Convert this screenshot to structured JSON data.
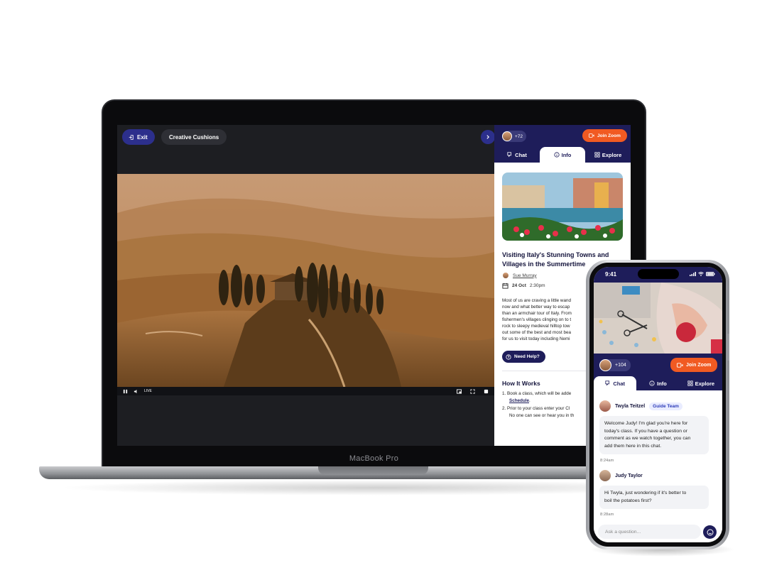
{
  "laptop": {
    "brand": "MacBook Pro",
    "header": {
      "exit_label": "Exit",
      "chip_label": "Creative Cushions"
    },
    "video": {
      "live_label": "LIVE"
    },
    "panel": {
      "attendee_count": "+72",
      "zoom_label": "Join Zoom",
      "tabs": [
        {
          "label": "Chat"
        },
        {
          "label": "Info"
        },
        {
          "label": "Explore"
        }
      ],
      "active_tab": "Info",
      "article": {
        "title_line1": "Visiting Italy's Stunning Towns and",
        "title_line2": "Villages in the Summertime",
        "host": "Sue Murray",
        "date_bold": "24 Oct",
        "time": "2:30pm",
        "body_lines": [
          "Most of us are craving a little wand",
          "now and what better way to escap",
          "than an armchair tour of Italy. From",
          "fishermen's villages clinging on to t",
          "rock to sleepy medieval hilltop tow",
          "out some of the best and most bea",
          "for us to visit today including Nemi"
        ]
      },
      "help_label": "Need Help?",
      "how_title": "How It Works",
      "steps": {
        "s1_a": "1. Book a class, which will be adde",
        "s1_b": "Schedule",
        "s1_b_tail": ".",
        "s2_a": "2. Prior to your class enter your Cl",
        "s2_b": "No one can see or hear you in th"
      }
    }
  },
  "phone": {
    "status_time": "9:41",
    "attendee_count": "+104",
    "zoom_label": "Join Zoom",
    "tabs": [
      {
        "label": "Chat"
      },
      {
        "label": "Info"
      },
      {
        "label": "Explore"
      }
    ],
    "active_tab": "Chat",
    "messages": [
      {
        "author": "Twyla Teitzel",
        "badge": "Guide Team",
        "lines": [
          "Welcome Judy! I'm glad you're here for",
          "today's class. If you have a question or",
          "comment as we watch together, you can",
          "add them here in this chat."
        ],
        "time": "8:24am"
      },
      {
        "author": "Judy Taylor",
        "lines": [
          "Hi Twyla, just wondering if it's better to",
          "boil the potatoes first?"
        ],
        "time": "8:28am"
      }
    ],
    "input_placeholder": "Ask a question..."
  },
  "colors": {
    "navy": "#1e1d5a",
    "accent_orange": "#f15a22",
    "exit_blue": "#2c2f8c"
  },
  "icons": [
    "exit-icon",
    "chevron-right-icon",
    "video-camera-icon",
    "chat-icon",
    "info-icon",
    "grid-icon",
    "calendar-icon",
    "help-icon",
    "pause-icon",
    "volume-icon",
    "pip-icon",
    "fullscreen-icon",
    "menu-icon",
    "smile-icon",
    "wifi-icon",
    "battery-icon",
    "signal-icon"
  ]
}
